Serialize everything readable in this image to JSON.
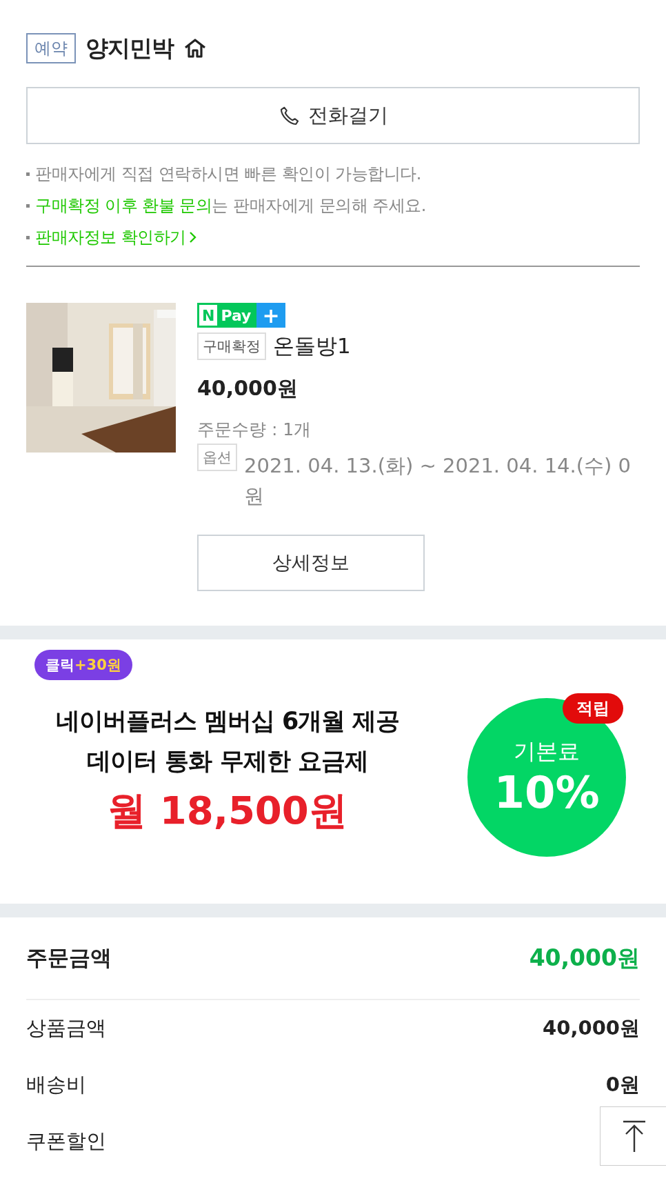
{
  "header": {
    "badge": "예약",
    "title": "양지민박"
  },
  "call_button": {
    "label": "전화걸기"
  },
  "notes": [
    {
      "kind": "plain",
      "parts": [
        {
          "text": "판매자에게 직접 연락하시면 빠른 확인이 가능합니다.",
          "highlight": false
        }
      ]
    },
    {
      "kind": "plain",
      "parts": [
        {
          "text": "구매확정 이후 환불 문의",
          "highlight": true
        },
        {
          "text": "는 판매자에게 문의해 주세요.",
          "highlight": false
        }
      ]
    },
    {
      "kind": "link",
      "parts": [
        {
          "text": "판매자정보 확인하기",
          "highlight": true
        }
      ]
    }
  ],
  "product": {
    "pay_badge": {
      "n": "N",
      "pay": "Pay",
      "plus": "+"
    },
    "status_tag": "구매확정",
    "name": "온돌방1",
    "price": "40,000원",
    "quantity": "주문수량 : 1개",
    "option_tag": "옵션",
    "option_text": "2021. 04. 13.(화) ~ 2021. 04. 14.(수) 0원",
    "detail_button": "상세정보"
  },
  "banner": {
    "click_badge": {
      "label": "클릭",
      "reward": "+30원"
    },
    "lines": [
      "네이버플러스 멤버십 6개월 제공",
      "데이터 통화 무제한 요금제"
    ],
    "price": "월 18,500원",
    "circle": {
      "tag": "적립",
      "label": "기본료",
      "value": "10%"
    }
  },
  "summary": {
    "total": {
      "label": "주문금액",
      "value": "40,000원"
    },
    "rows": [
      {
        "label": "상품금액",
        "value": "40,000원"
      },
      {
        "label": "배송비",
        "value": "0원"
      },
      {
        "label": "쿠폰할인"
      }
    ]
  }
}
